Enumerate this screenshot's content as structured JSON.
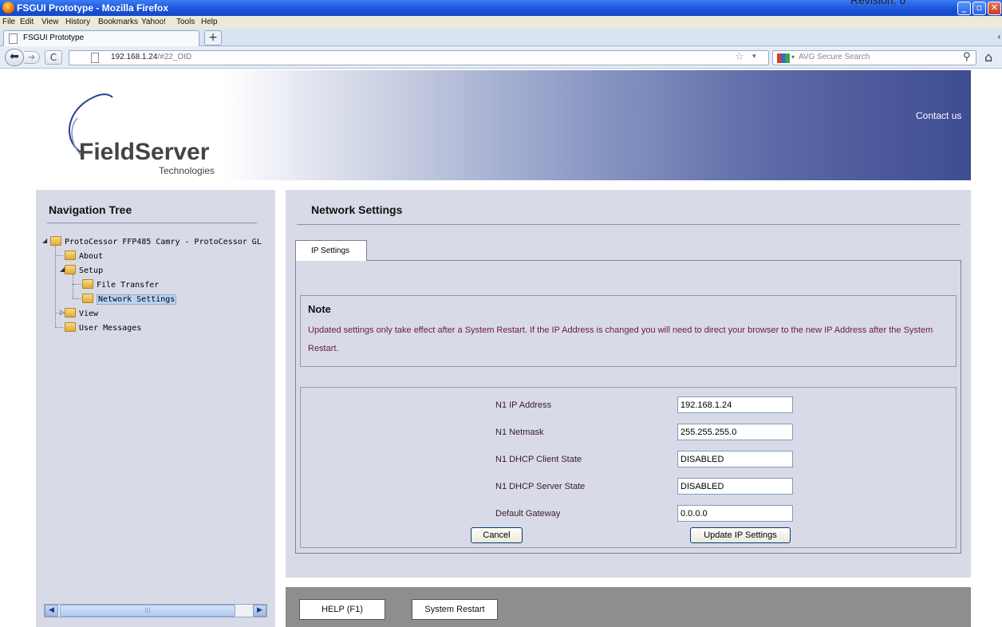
{
  "document": {
    "revision_text": "Revision: 6"
  },
  "browser": {
    "window_title": "FSGUI Prototype - Mozilla Firefox",
    "menu": [
      "File",
      "Edit",
      "View",
      "History",
      "Bookmarks",
      "Yahoo!",
      "Tools",
      "Help"
    ],
    "tab_label": "FSGUI Prototype",
    "new_tab": "+",
    "url_host": "192.168.1.24",
    "url_path": "/#22_OID",
    "search_placeholder": "AVG Secure Search"
  },
  "header": {
    "logo_main": "FieldServer",
    "logo_sub": "Technologies",
    "contact_label": "Contact us"
  },
  "sidebar": {
    "title": "Navigation Tree",
    "tree": {
      "root": "ProtoCessor FFP485 Camry - ProtoCessor GL",
      "about": "About",
      "setup": "Setup",
      "file_transfer": "File Transfer",
      "network_settings": "Network Settings",
      "view": "View",
      "user_messages": "User Messages"
    }
  },
  "main": {
    "title": "Network Settings",
    "tab_label": "IP Settings",
    "note": {
      "title": "Note",
      "text": "Updated settings only take effect after a System Restart. If the IP Address is changed you will need to direct your browser to the new IP Address after the System Restart."
    },
    "fields": {
      "ip_label": "N1 IP Address",
      "ip_value": "192.168.1.24",
      "netmask_label": "N1 Netmask",
      "netmask_value": "255.255.255.0",
      "dhcp_client_label": "N1 DHCP Client State",
      "dhcp_client_value": "DISABLED",
      "dhcp_server_label": "N1 DHCP Server State",
      "dhcp_server_value": "DISABLED",
      "gateway_label": "Default Gateway",
      "gateway_value": "0.0.0.0"
    },
    "cancel_label": "Cancel",
    "update_label": "Update IP Settings"
  },
  "footer": {
    "help_label": "HELP (F1)",
    "restart_label": "System Restart"
  },
  "colors": {
    "panel_bg": "#d8dbe7",
    "note_text": "#6b1a3a",
    "title_bar": "#1a52d8",
    "footer_bg": "#8e8e8e"
  }
}
